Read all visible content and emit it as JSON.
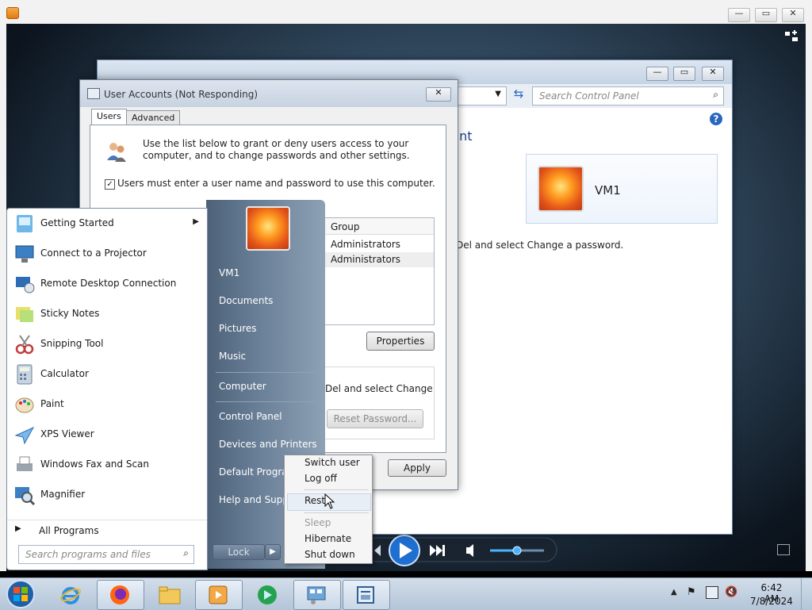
{
  "player": {
    "title_minimize": "—",
    "title_restore": "▭",
    "title_close": "✕"
  },
  "control_panel": {
    "search_placeholder": "Search Control Panel",
    "heading_partial": "unt",
    "user_name": "VM1",
    "ctrl_alt_del_text": "Del and select Change a password.",
    "help_label": "?"
  },
  "user_accounts": {
    "title": "User Accounts (Not Responding)",
    "tabs": [
      "Users",
      "Advanced"
    ],
    "intro": "Use the list below to grant or deny users access to your computer, and to change passwords and other settings.",
    "checkbox_label": "Users must enter a user name and password to use this computer.",
    "checkbox_checked": true,
    "table_header": "Group",
    "rows": [
      "Administrators",
      "Administrators"
    ],
    "properties_button": "Properties",
    "change_password_text": "Del and select Change",
    "reset_password_button": "Reset Password...",
    "apply_button": "Apply"
  },
  "start_menu": {
    "programs": [
      {
        "label": "Getting Started",
        "has_arrow": true
      },
      {
        "label": "Connect to a Projector"
      },
      {
        "label": "Remote Desktop Connection"
      },
      {
        "label": "Sticky Notes"
      },
      {
        "label": "Snipping Tool"
      },
      {
        "label": "Calculator"
      },
      {
        "label": "Paint"
      },
      {
        "label": "XPS Viewer"
      },
      {
        "label": "Windows Fax and Scan"
      },
      {
        "label": "Magnifier"
      }
    ],
    "all_programs": "All Programs",
    "search_placeholder": "Search programs and files",
    "right_items": [
      "VM1",
      "Documents",
      "Pictures",
      "Music",
      "Computer",
      "Control Panel",
      "Devices and Printers",
      "Default Programs",
      "Help and Support"
    ],
    "lock_button": "Lock"
  },
  "shutdown_menu": {
    "items": [
      "Switch user",
      "Log off",
      "Restart",
      "Sleep",
      "Hibernate",
      "Shut down"
    ],
    "restart_visible": "Rest"
  },
  "taskbar": {
    "time": "6:42 AM",
    "date": "7/8/2024"
  }
}
